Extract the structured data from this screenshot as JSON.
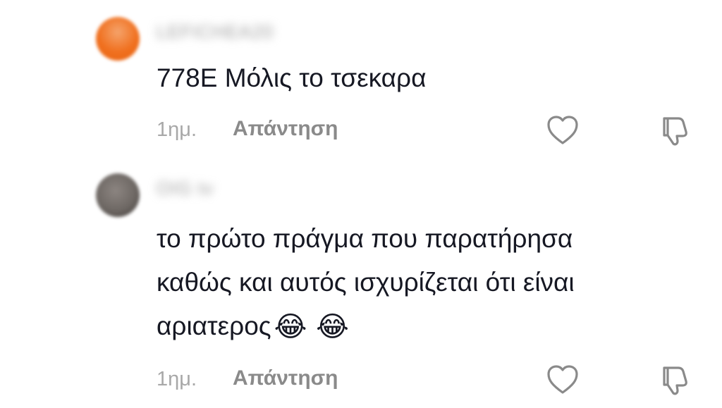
{
  "comments": [
    {
      "username": "LEFICHEA20",
      "avatar_color": "#f0701f",
      "text_lines": [
        "778E Μόλις το τσεκαρα"
      ],
      "timestamp": "1ημ.",
      "reply_label": "Απάντηση",
      "icons": {
        "like": "heart-outline-icon",
        "dislike": "thumbs-down-outline-icon"
      }
    },
    {
      "username": "OIG tv",
      "avatar_color": "#6e6864",
      "text_lines": [
        "το πρώτο πράγμα που παρατήρησα",
        "καθώς και αυτός ισχυρίζεται ότι είναι",
        "αριατερος"
      ],
      "emoji": "😂 😂",
      "timestamp": "1ημ.",
      "reply_label": "Απάντηση",
      "icons": {
        "like": "heart-outline-icon",
        "dislike": "thumbs-down-outline-icon"
      }
    }
  ],
  "colors": {
    "text": "#161823",
    "meta": "#a8a8a8",
    "icon": "#8a8a8a"
  }
}
